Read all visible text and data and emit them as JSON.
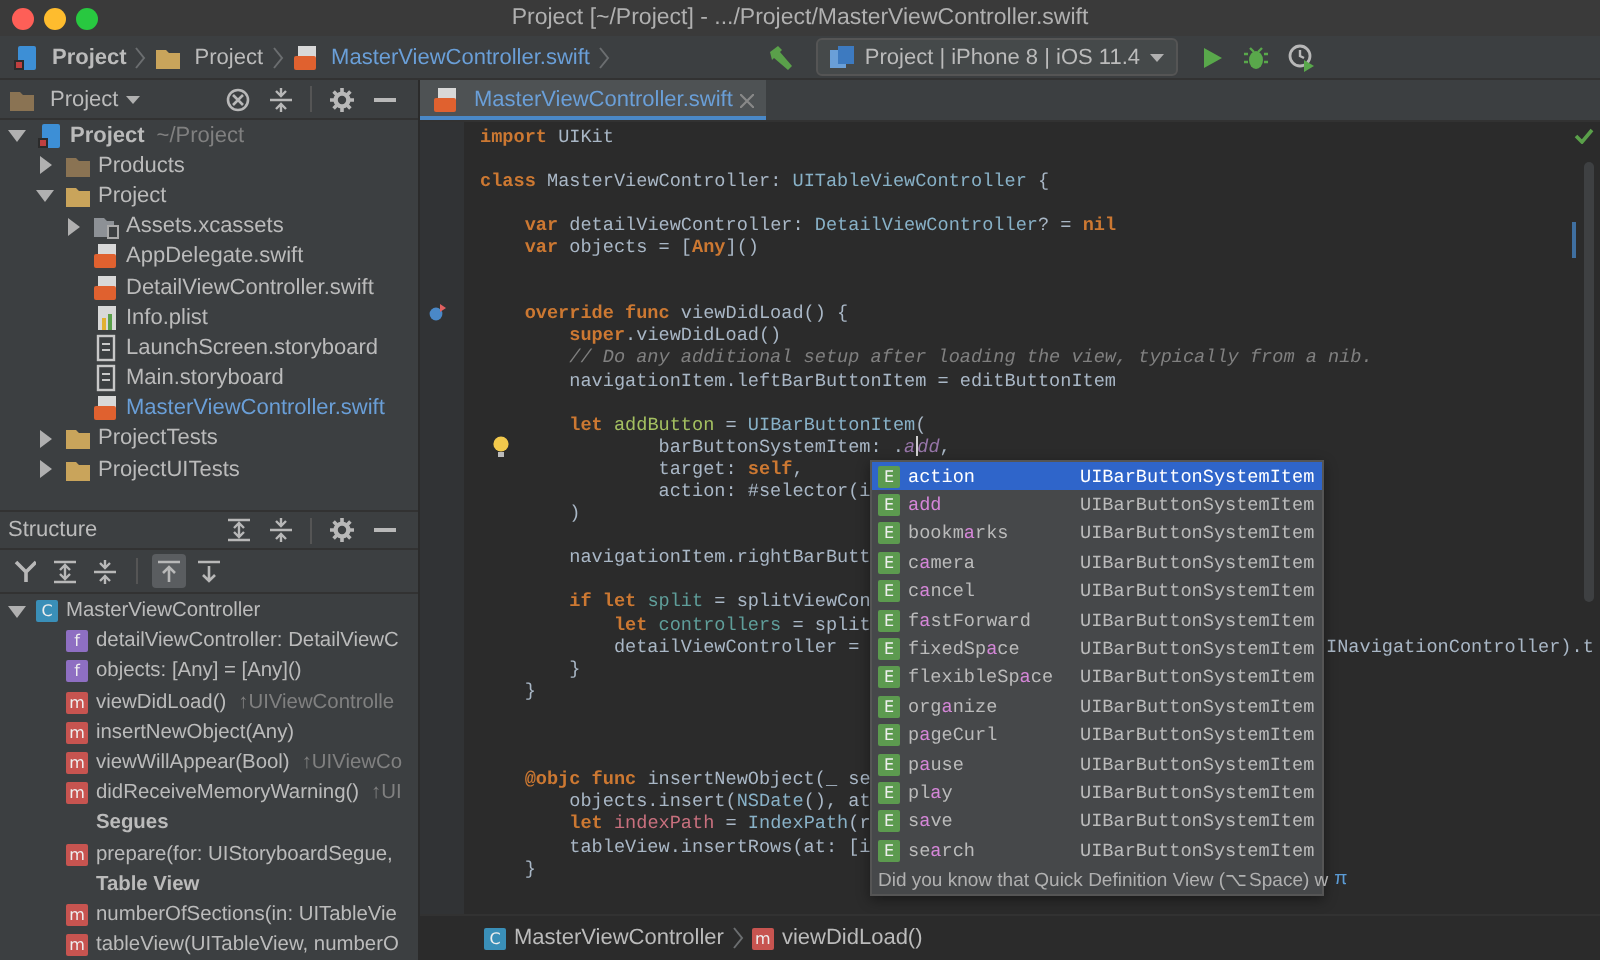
{
  "window": {
    "title": "Project [~/Project] - .../Project/MasterViewController.swift"
  },
  "navigation_bar": {
    "path": [
      {
        "label": "Project",
        "kind": "project"
      },
      {
        "label": "Project",
        "kind": "folder"
      },
      {
        "label": "MasterViewController.swift",
        "kind": "swift"
      }
    ],
    "run_configuration": "Project | iPhone 8 | iOS 11.4"
  },
  "project_panel": {
    "title": "Project",
    "tree": [
      {
        "label": "Project",
        "secondary": "~/Project",
        "kind": "project",
        "expanded": true,
        "current": false,
        "children": [
          {
            "label": "Products",
            "kind": "products",
            "expanded": false,
            "current": false
          },
          {
            "label": "Project",
            "kind": "folder",
            "expanded": true,
            "current": false,
            "children": [
              {
                "label": "Assets.xcassets",
                "kind": "assets",
                "expanded": false,
                "current": false
              },
              {
                "label": "AppDelegate.swift",
                "kind": "swift",
                "current": false
              },
              {
                "label": "DetailViewController.swift",
                "kind": "swift",
                "current": false
              },
              {
                "label": "Info.plist",
                "kind": "plist",
                "current": false
              },
              {
                "label": "LaunchScreen.storyboard",
                "kind": "storyboard",
                "current": false
              },
              {
                "label": "Main.storyboard",
                "kind": "storyboard",
                "current": false
              },
              {
                "label": "MasterViewController.swift",
                "kind": "swift",
                "current": true
              }
            ]
          },
          {
            "label": "ProjectTests",
            "kind": "folder",
            "expanded": false,
            "current": false
          },
          {
            "label": "ProjectUITests",
            "kind": "folder",
            "expanded": false,
            "current": false
          }
        ]
      }
    ]
  },
  "structure_panel": {
    "title": "Structure",
    "toolbar": [
      {
        "kind": "hierarchy",
        "selected": false
      },
      {
        "kind": "expand",
        "selected": false
      },
      {
        "kind": "collapse",
        "selected": false
      },
      {
        "kind": "scroll_from",
        "selected": true
      },
      {
        "kind": "scroll_to",
        "selected": false
      }
    ],
    "tree": [
      {
        "kind": "class",
        "badge": "C",
        "label": "MasterViewController",
        "expanded": true,
        "children": [
          {
            "kind": "field",
            "badge": "f",
            "label": "detailViewController: DetailViewC"
          },
          {
            "kind": "field",
            "badge": "f",
            "label": "objects: [Any] = [Any]()"
          },
          {
            "kind": "method",
            "badge": "m",
            "label": "viewDidLoad()",
            "suffix": "↑UIViewControlle"
          },
          {
            "kind": "method",
            "badge": "m",
            "label": "insertNewObject(Any)"
          },
          {
            "kind": "method",
            "badge": "m",
            "label": "viewWillAppear(Bool)",
            "suffix": "↑UIViewCo"
          },
          {
            "kind": "method",
            "badge": "m",
            "label": "didReceiveMemoryWarning()",
            "suffix": "↑UI"
          },
          {
            "kind": "section",
            "label": "Segues"
          },
          {
            "kind": "method",
            "badge": "m",
            "label": "prepare(for: UIStoryboardSegue,"
          },
          {
            "kind": "section",
            "label": "Table View"
          },
          {
            "kind": "method",
            "badge": "m",
            "label": "numberOfSections(in: UITableVie"
          },
          {
            "kind": "method",
            "badge": "m",
            "label": "tableView(UITableView, numberO"
          }
        ]
      }
    ]
  },
  "editor": {
    "tabs": [
      {
        "label": "MasterViewController.swift",
        "selected": true
      }
    ],
    "lines": [
      {
        "kind": "code",
        "tokens": [
          {
            "kind": "keyword",
            "text": "import"
          },
          {
            "kind": "plain",
            "text": " UIKit"
          }
        ]
      },
      {
        "kind": "blank"
      },
      {
        "kind": "code",
        "tokens": [
          {
            "kind": "keyword",
            "text": "class"
          },
          {
            "kind": "plain",
            "text": " MasterViewController: "
          },
          {
            "kind": "type",
            "text": "UITableViewController"
          },
          {
            "kind": "plain",
            "text": " {"
          }
        ]
      },
      {
        "kind": "blank"
      },
      {
        "kind": "code",
        "tokens": [
          {
            "kind": "keyword",
            "text": "    var"
          },
          {
            "kind": "plain",
            "text": " detailViewController: "
          },
          {
            "kind": "type",
            "text": "DetailViewController"
          },
          {
            "kind": "plain",
            "text": "? = "
          },
          {
            "kind": "keyword",
            "text": "nil"
          }
        ]
      },
      {
        "kind": "code",
        "tokens": [
          {
            "kind": "keyword",
            "text": "    var"
          },
          {
            "kind": "plain",
            "text": " objects = ["
          },
          {
            "kind": "keyword",
            "text": "Any"
          },
          {
            "kind": "plain",
            "text": "]()"
          }
        ]
      },
      {
        "kind": "blank"
      },
      {
        "kind": "blank"
      },
      {
        "kind": "code",
        "marker": {
          "kind": "override"
        },
        "tokens": [
          {
            "kind": "keyword",
            "text": "    override func"
          },
          {
            "kind": "plain",
            "text": " viewDidLoad() {"
          }
        ]
      },
      {
        "kind": "code",
        "tokens": [
          {
            "kind": "keyword",
            "text": "        super"
          },
          {
            "kind": "plain",
            "text": ".viewDidLoad()"
          }
        ]
      },
      {
        "kind": "code",
        "tokens": [
          {
            "kind": "comment",
            "text": "        // Do any additional setup after loading the view, typically from a nib."
          }
        ]
      },
      {
        "kind": "code",
        "tokens": [
          {
            "kind": "plain",
            "text": "        navigationItem.leftBarButtonItem = editButtonItem"
          }
        ]
      },
      {
        "kind": "blank"
      },
      {
        "kind": "code",
        "tokens": [
          {
            "kind": "keyword",
            "text": "        let"
          },
          {
            "kind": "local",
            "text": " addButton"
          },
          {
            "kind": "plain",
            "text": " = "
          },
          {
            "kind": "type",
            "text": "UIBarButtonItem"
          },
          {
            "kind": "plain",
            "text": "("
          }
        ]
      },
      {
        "kind": "code",
        "marker": {
          "kind": "bulb"
        },
        "tokens": [
          {
            "kind": "plain",
            "text": "                barButtonSystemItem: ."
          },
          {
            "kind": "member",
            "text": "a"
          },
          {
            "kind": "caret"
          },
          {
            "kind": "member",
            "text": "dd"
          },
          {
            "kind": "plain",
            "text": ","
          }
        ]
      },
      {
        "kind": "code",
        "tokens": [
          {
            "kind": "plain",
            "text": "                target: "
          },
          {
            "kind": "keyword",
            "text": "self"
          },
          {
            "kind": "plain",
            "text": ","
          }
        ]
      },
      {
        "kind": "code",
        "tokens": [
          {
            "kind": "plain",
            "text": "                action: #selector(i"
          }
        ]
      },
      {
        "kind": "code",
        "tokens": [
          {
            "kind": "plain",
            "text": "        )"
          }
        ]
      },
      {
        "kind": "blank"
      },
      {
        "kind": "code",
        "tokens": [
          {
            "kind": "plain",
            "text": "        navigationItem.rightBarButt"
          }
        ]
      },
      {
        "kind": "blank"
      },
      {
        "kind": "code",
        "tokens": [
          {
            "kind": "keyword",
            "text": "        if let"
          },
          {
            "kind": "bound",
            "text": " split"
          },
          {
            "kind": "plain",
            "text": " = splitViewCon"
          }
        ]
      },
      {
        "kind": "code",
        "tokens": [
          {
            "kind": "keyword",
            "text": "            let"
          },
          {
            "kind": "bound",
            "text": " controllers"
          },
          {
            "kind": "plain",
            "text": " = split"
          }
        ]
      },
      {
        "kind": "code",
        "tokens": [
          {
            "kind": "plain",
            "text": "            detailViewController = "
          }
        ],
        "tail": "INavigationController).t"
      },
      {
        "kind": "code",
        "tokens": [
          {
            "kind": "plain",
            "text": "        }"
          }
        ]
      },
      {
        "kind": "code",
        "tokens": [
          {
            "kind": "plain",
            "text": "    }"
          }
        ]
      },
      {
        "kind": "blank"
      },
      {
        "kind": "blank"
      },
      {
        "kind": "blank"
      },
      {
        "kind": "code",
        "tokens": [
          {
            "kind": "keyword",
            "text": "    @objc func"
          },
          {
            "kind": "plain",
            "text": " insertNewObject(_ se"
          }
        ]
      },
      {
        "kind": "code",
        "tokens": [
          {
            "kind": "plain",
            "text": "        objects.insert("
          },
          {
            "kind": "type",
            "text": "NSDate"
          },
          {
            "kind": "plain",
            "text": "(), at"
          }
        ]
      },
      {
        "kind": "code",
        "tokens": [
          {
            "kind": "keyword",
            "text": "        let"
          },
          {
            "kind": "var",
            "text": " indexPath"
          },
          {
            "kind": "plain",
            "text": " = "
          },
          {
            "kind": "type",
            "text": "IndexPath"
          },
          {
            "kind": "plain",
            "text": "(r"
          }
        ]
      },
      {
        "kind": "code",
        "tokens": [
          {
            "kind": "plain",
            "text": "        tableView.insertRows(at: [i"
          }
        ]
      },
      {
        "kind": "code",
        "tokens": [
          {
            "kind": "plain",
            "text": "    }"
          }
        ]
      }
    ],
    "completion": {
      "items": [
        {
          "badge": "E",
          "parts": [
            {
              "text": "action",
              "matched": false
            }
          ],
          "type": "UIBarButtonSystemItem",
          "selected": true
        },
        {
          "badge": "E",
          "parts": [
            {
              "text": "add",
              "matched": true
            }
          ],
          "type": "UIBarButtonSystemItem",
          "selected": false
        },
        {
          "badge": "E",
          "parts": [
            {
              "text": "bookm",
              "matched": false
            },
            {
              "text": "a",
              "matched": true
            },
            {
              "text": "rks",
              "matched": false
            }
          ],
          "type": "UIBarButtonSystemItem",
          "selected": false
        },
        {
          "badge": "E",
          "parts": [
            {
              "text": "c",
              "matched": false
            },
            {
              "text": "a",
              "matched": true
            },
            {
              "text": "mera",
              "matched": false
            }
          ],
          "type": "UIBarButtonSystemItem",
          "selected": false
        },
        {
          "badge": "E",
          "parts": [
            {
              "text": "c",
              "matched": false
            },
            {
              "text": "a",
              "matched": true
            },
            {
              "text": "ncel",
              "matched": false
            }
          ],
          "type": "UIBarButtonSystemItem",
          "selected": false
        },
        {
          "badge": "E",
          "parts": [
            {
              "text": "f",
              "matched": false
            },
            {
              "text": "a",
              "matched": true
            },
            {
              "text": "stForward",
              "matched": false
            }
          ],
          "type": "UIBarButtonSystemItem",
          "selected": false
        },
        {
          "badge": "E",
          "parts": [
            {
              "text": "fixedSp",
              "matched": false
            },
            {
              "text": "a",
              "matched": true
            },
            {
              "text": "ce",
              "matched": false
            }
          ],
          "type": "UIBarButtonSystemItem",
          "selected": false
        },
        {
          "badge": "E",
          "parts": [
            {
              "text": "flexibleSp",
              "matched": false
            },
            {
              "text": "a",
              "matched": true
            },
            {
              "text": "ce",
              "matched": false
            }
          ],
          "type": "UIBarButtonSystemItem",
          "selected": false
        },
        {
          "badge": "E",
          "parts": [
            {
              "text": "org",
              "matched": false
            },
            {
              "text": "a",
              "matched": true
            },
            {
              "text": "nize",
              "matched": false
            }
          ],
          "type": "UIBarButtonSystemItem",
          "selected": false
        },
        {
          "badge": "E",
          "parts": [
            {
              "text": "p",
              "matched": false
            },
            {
              "text": "a",
              "matched": true
            },
            {
              "text": "geCurl",
              "matched": false
            }
          ],
          "type": "UIBarButtonSystemItem",
          "selected": false
        },
        {
          "badge": "E",
          "parts": [
            {
              "text": "p",
              "matched": false
            },
            {
              "text": "a",
              "matched": true
            },
            {
              "text": "use",
              "matched": false
            }
          ],
          "type": "UIBarButtonSystemItem",
          "selected": false
        },
        {
          "badge": "E",
          "parts": [
            {
              "text": "pl",
              "matched": false
            },
            {
              "text": "a",
              "matched": true
            },
            {
              "text": "y",
              "matched": false
            }
          ],
          "type": "UIBarButtonSystemItem",
          "selected": false
        },
        {
          "badge": "E",
          "parts": [
            {
              "text": "s",
              "matched": false
            },
            {
              "text": "a",
              "matched": true
            },
            {
              "text": "ve",
              "matched": false
            }
          ],
          "type": "UIBarButtonSystemItem",
          "selected": false
        },
        {
          "badge": "E",
          "parts": [
            {
              "text": "se",
              "matched": false
            },
            {
              "text": "a",
              "matched": true
            },
            {
              "text": "rch",
              "matched": false
            }
          ],
          "type": "UIBarButtonSystemItem",
          "selected": false
        }
      ],
      "hint": "Did you know that Quick Definition View (⌥Space) w",
      "hint_mark": "π"
    },
    "breadcrumb": [
      {
        "kind": "class",
        "badge": "C",
        "label": "MasterViewController"
      },
      {
        "kind": "method",
        "badge": "m",
        "label": "viewDidLoad()"
      }
    ]
  }
}
